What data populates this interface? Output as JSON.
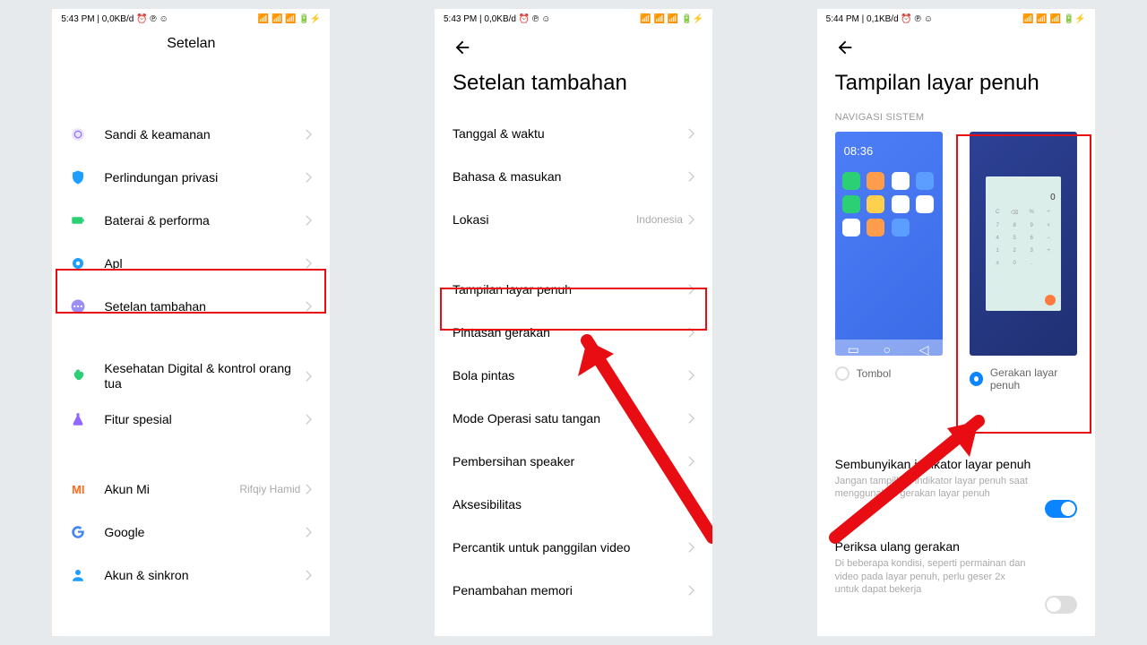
{
  "status": {
    "time1": "5:43 PM",
    "rate1": "0,0KB/d",
    "time2": "5:43 PM",
    "rate2": "0,0KB/d",
    "time3": "5:44 PM",
    "rate3": "0,1KB/d"
  },
  "p1": {
    "title": "Setelan",
    "items": [
      {
        "icon": "fingerprint",
        "color": "#8e68ff",
        "label": "Sandi & keamanan"
      },
      {
        "icon": "shield",
        "color": "#1e9eff",
        "label": "Perlindungan privasi"
      },
      {
        "icon": "battery",
        "color": "#2bd074",
        "label": "Baterai & performa"
      },
      {
        "icon": "gear",
        "color": "#1e9eff",
        "label": "Apl"
      },
      {
        "icon": "dots",
        "color": "#9b8ef4",
        "label": "Setelan tambahan",
        "hl": true
      }
    ],
    "items2": [
      {
        "icon": "heart",
        "color": "#2bd074",
        "label": "Kesehatan Digital & kontrol orang tua",
        "two": true
      },
      {
        "icon": "flask",
        "color": "#8e68ff",
        "label": "Fitur spesial"
      }
    ],
    "items3": [
      {
        "icon": "mi",
        "color": "#ff6b1a",
        "label": "Akun Mi",
        "val": "Rifqiy Hamid"
      },
      {
        "icon": "g",
        "label": "Google"
      },
      {
        "icon": "person",
        "color": "#1e9eff",
        "label": "Akun & sinkron"
      }
    ]
  },
  "p2": {
    "title": "Setelan tambahan",
    "group1": [
      {
        "label": "Tanggal & waktu"
      },
      {
        "label": "Bahasa & masukan"
      },
      {
        "label": "Lokasi",
        "val": "Indonesia"
      }
    ],
    "group2": [
      {
        "label": "Tampilan layar penuh",
        "hl": true
      },
      {
        "label": "Pintasan gerakan"
      },
      {
        "label": "Bola pintas"
      },
      {
        "label": "Mode Operasi satu tangan"
      },
      {
        "label": "Pembersihan speaker"
      },
      {
        "label": "Aksesibilitas"
      },
      {
        "label": "Percantik untuk panggilan video"
      },
      {
        "label": "Penambahan memori"
      }
    ]
  },
  "p3": {
    "title": "Tampilan layar penuh",
    "section": "NAVIGASI SISTEM",
    "preview_time": "08:36",
    "opt_buttons": "Tombol",
    "opt_gesture": "Gerakan layar penuh",
    "sw1_t": "Sembunyikan indikator layar penuh",
    "sw1_d": "Jangan tampilkan indikator layar penuh saat menggunakan gerakan layar penuh",
    "sw2_t": "Periksa ulang gerakan",
    "sw2_d": "Di beberapa kondisi, seperti permainan dan video pada layar penuh, perlu geser 2x untuk dapat bekerja",
    "apps": [
      "#2bd074",
      "#ff9d4d",
      "#fff",
      "#5b9eff",
      "#2bd074",
      "#ffd04d",
      "#fff",
      "#fff",
      "#fff",
      "#ff9d4d",
      "#5b9eff"
    ]
  }
}
